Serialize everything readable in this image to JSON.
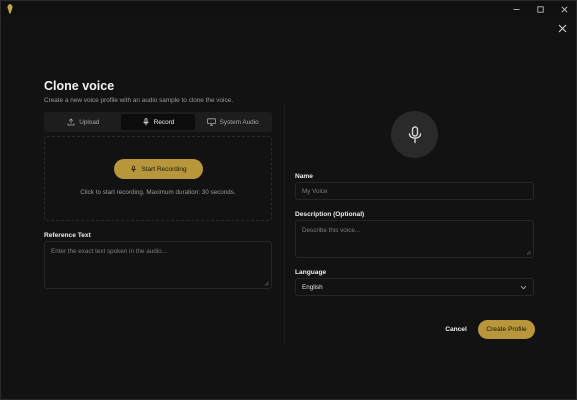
{
  "window": {
    "icons": {
      "logo": "app-logo-icon",
      "minimize": "minimize-icon",
      "maximize": "maximize-icon",
      "close": "close-icon"
    }
  },
  "dialog": {
    "title": "Clone voice",
    "subtitle": "Create a new voice profile with an audio sample to clone the voice.",
    "close_icon": "close-icon"
  },
  "source_tabs": [
    {
      "label": "Upload",
      "icon": "upload-icon",
      "active": false
    },
    {
      "label": "Record",
      "icon": "microphone-icon",
      "active": true
    },
    {
      "label": "System Audio",
      "icon": "monitor-icon",
      "active": false
    }
  ],
  "recorder": {
    "start_label": "Start Recording",
    "hint": "Click to start recording. Maximum duration: 30 seconds."
  },
  "reference_text": {
    "label": "Reference Text",
    "placeholder": "Enter the exact text spoken in the audio..."
  },
  "profile": {
    "avatar_icon": "microphone-icon",
    "name_label": "Name",
    "name_placeholder": "My Voice",
    "description_label": "Description (Optional)",
    "description_placeholder": "Describe this voice...",
    "language_label": "Language",
    "language_value": "English"
  },
  "actions": {
    "cancel_label": "Cancel",
    "create_label": "Create Profile"
  },
  "colors": {
    "accent": "#b8973c",
    "background": "#121212"
  }
}
